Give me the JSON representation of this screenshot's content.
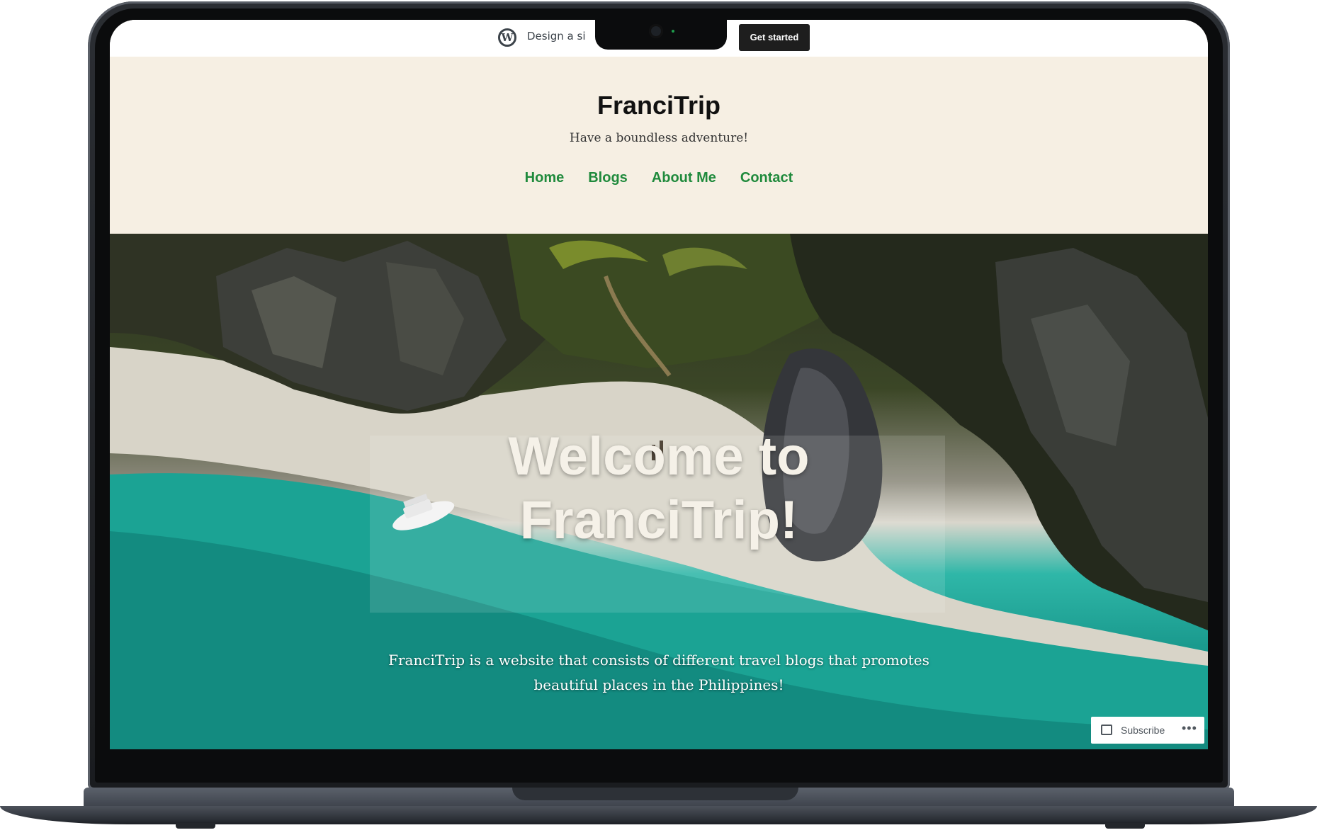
{
  "topbar": {
    "wordpress_logo": "W",
    "design_text": "Design a site l",
    "get_started_label": "Get started"
  },
  "site": {
    "title": "FranciTrip",
    "tagline": "Have a boundless adventure!"
  },
  "nav": {
    "items": [
      {
        "label": "Home"
      },
      {
        "label": "Blogs"
      },
      {
        "label": "About Me"
      },
      {
        "label": "Contact"
      }
    ]
  },
  "hero": {
    "title_line1": "Welcome to",
    "title_line2": "FranciTrip!",
    "description": "FranciTrip is a website that consists of different travel blogs that promotes beautiful places in the Philippines!"
  },
  "subscribe_widget": {
    "label": "Subscribe",
    "more_icon": "ellipsis-icon"
  },
  "colors": {
    "header_bg": "#f6efe3",
    "nav_link": "#1f8a3c",
    "get_started_bg": "#1e1e1e"
  }
}
